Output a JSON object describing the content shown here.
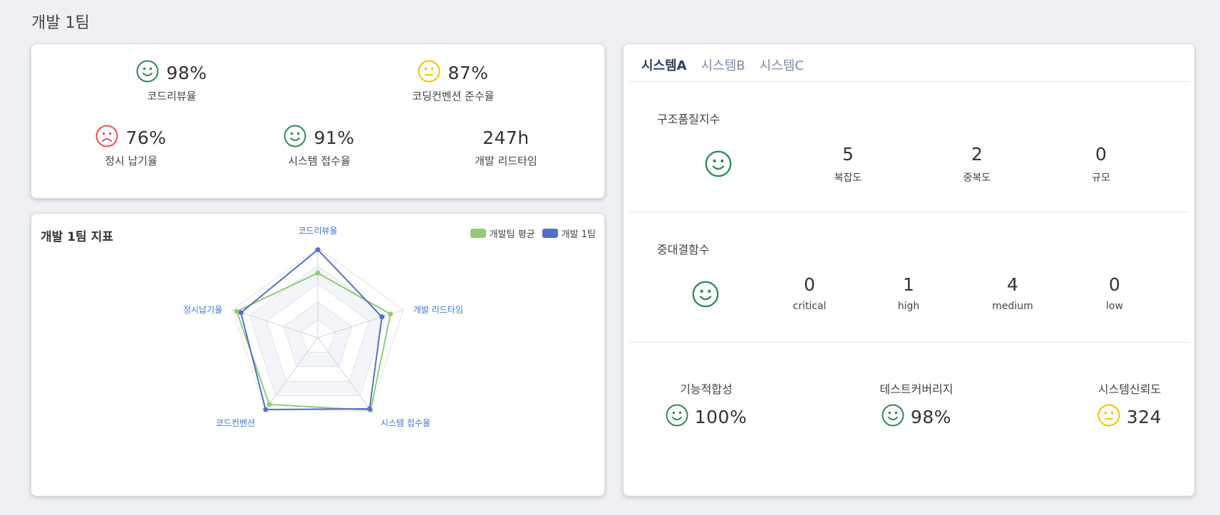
{
  "page": {
    "title": "개발 1팀"
  },
  "kpis": [
    {
      "value": "98%",
      "label": "코드리뷰율",
      "status": "good"
    },
    {
      "value": "87%",
      "label": "코딩컨벤션 준수율",
      "status": "neutral"
    },
    {
      "value": "76%",
      "label": "정시 납기율",
      "status": "bad"
    },
    {
      "value": "91%",
      "label": "시스템 접수율",
      "status": "good"
    },
    {
      "value": "247h",
      "label": "개발 리드타임"
    }
  ],
  "chart_data": {
    "type": "radar",
    "title": "개발 1팀 지표",
    "axes": [
      "코드리뷰율",
      "개발 리드타임",
      "시스템 접수율",
      "코드컨벤션",
      "정시납기율"
    ],
    "max": 100,
    "levels": 5,
    "series": [
      {
        "name": "개발팀 평균",
        "color": "#91cc75",
        "values": [
          72,
          85,
          100,
          92,
          95
        ]
      },
      {
        "name": "개발 1팀",
        "color": "#5470c6",
        "values": [
          98,
          75,
          98,
          99,
          90
        ]
      }
    ],
    "legend_position": "top-right"
  },
  "system_panel": {
    "tabs": [
      "시스템A",
      "시스템B",
      "시스템C"
    ],
    "active_tab": 0,
    "structural_quality": {
      "title": "구조품질지수",
      "status": "good",
      "metrics": [
        {
          "value": "5",
          "label": "복잡도"
        },
        {
          "value": "2",
          "label": "중복도"
        },
        {
          "value": "0",
          "label": "규모"
        }
      ]
    },
    "critical_defects": {
      "title": "중대결함수",
      "status": "good",
      "metrics": [
        {
          "value": "0",
          "label": "critical"
        },
        {
          "value": "1",
          "label": "high"
        },
        {
          "value": "4",
          "label": "medium"
        },
        {
          "value": "0",
          "label": "low"
        }
      ]
    },
    "bottom": [
      {
        "label": "기능적합성",
        "value": "100%",
        "status": "good"
      },
      {
        "label": "테스트커버리지",
        "value": "98%",
        "status": "good"
      },
      {
        "label": "시스템신뢰도",
        "value": "324",
        "status": "neutral"
      }
    ]
  },
  "colors": {
    "good": "#2e8b57",
    "neutral": "#f2c200",
    "bad": "#e55353",
    "label_blue": "#3a7bd5"
  }
}
